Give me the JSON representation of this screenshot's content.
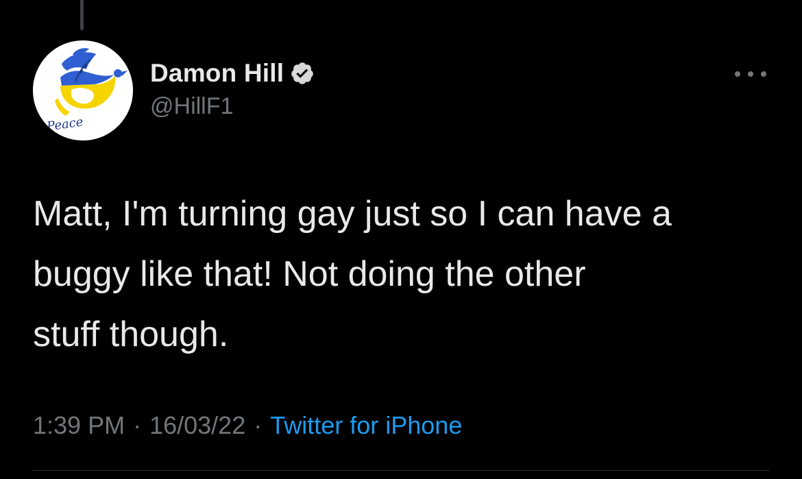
{
  "tweet": {
    "author": {
      "display_name": "Damon Hill",
      "handle": "@HillF1",
      "verified": true,
      "avatar_text": "Peace"
    },
    "text": "Matt, I'm turning gay just so I can have a\nbuggy like that! Not doing the other\nstuff though.",
    "time": "1:39 PM",
    "separator": "·",
    "date": "16/03/22",
    "source": "Twitter for iPhone"
  },
  "icons": {
    "verified": "verified-badge-icon",
    "more": "more-options-icon"
  },
  "colors": {
    "background": "#000000",
    "primary_text": "#e7e9ea",
    "secondary_text": "#71767b",
    "link": "#1d9bf0",
    "avatar_blue": "#2f5fd0",
    "avatar_yellow": "#f5d400"
  }
}
